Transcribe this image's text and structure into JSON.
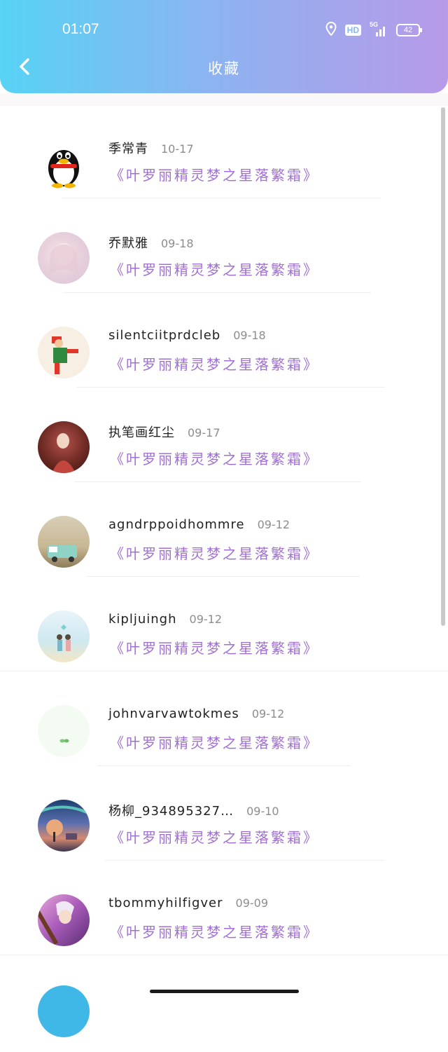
{
  "status_bar": {
    "time": "01:07",
    "hd": "HD",
    "network": "5G",
    "battery": "42"
  },
  "header": {
    "title": "收藏"
  },
  "favorites": [
    {
      "name": "季常青",
      "date": "10-17",
      "book": "《叶罗丽精灵梦之星落繁霜》"
    },
    {
      "name": "乔默雅",
      "date": "09-18",
      "book": "《叶罗丽精灵梦之星落繁霜》"
    },
    {
      "name": "silentciitprdcleb",
      "date": "09-18",
      "book": "《叶罗丽精灵梦之星落繁霜》"
    },
    {
      "name": "执笔画红尘",
      "date": "09-17",
      "book": "《叶罗丽精灵梦之星落繁霜》"
    },
    {
      "name": "agndrppoidhommre",
      "date": "09-12",
      "book": "《叶罗丽精灵梦之星落繁霜》"
    },
    {
      "name": "kipljuingh",
      "date": "09-12",
      "book": "《叶罗丽精灵梦之星落繁霜》"
    },
    {
      "name": "johnvarvawtokmes",
      "date": "09-12",
      "book": "《叶罗丽精灵梦之星落繁霜》"
    },
    {
      "name": "杨柳_934895327…",
      "date": "09-10",
      "book": "《叶罗丽精灵梦之星落繁霜》"
    },
    {
      "name": "tbommyhilfigver",
      "date": "09-09",
      "book": "《叶罗丽精灵梦之星落繁霜》"
    }
  ],
  "colors": {
    "accent_purple": "#a071d2",
    "header_start": "#57d3f4",
    "header_end": "#b79ae8"
  },
  "icons": [
    "location-icon",
    "signal-icon",
    "battery-icon",
    "back-chevron-icon"
  ]
}
